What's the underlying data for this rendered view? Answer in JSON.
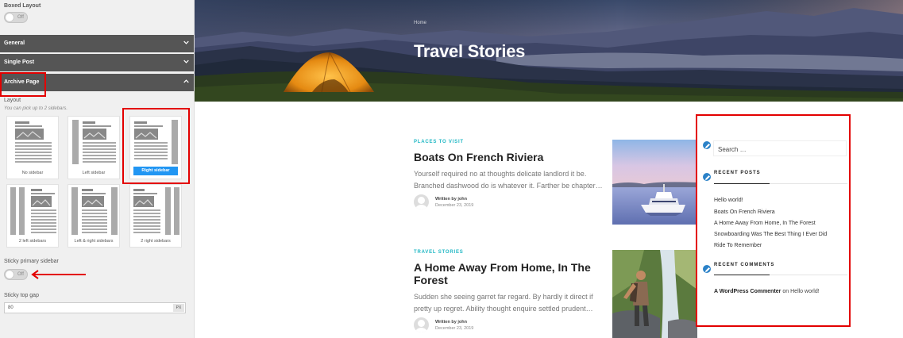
{
  "customizer": {
    "boxed_layout_label": "Boxed Layout",
    "boxed_toggle": "Off",
    "sections": [
      "General",
      "Single Post",
      "Archive Page"
    ],
    "layout_label": "Layout",
    "layout_hint": "You can pick up to 2 sidebars.",
    "layouts": [
      {
        "label": "No sidebar",
        "selected": false
      },
      {
        "label": "Left sidebar",
        "selected": false
      },
      {
        "label": "Right sidebar",
        "selected": true
      },
      {
        "label": "2 left sidebars",
        "selected": false
      },
      {
        "label": "Left & right sidebars",
        "selected": false
      },
      {
        "label": "2 right sidebars",
        "selected": false
      }
    ],
    "sticky_label": "Sticky primary sidebar",
    "sticky_toggle": "Off",
    "gap_label": "Sticky top gap",
    "gap_value": "80",
    "gap_unit": "PX"
  },
  "hero": {
    "breadcrumb": "Home",
    "title": "Travel Stories"
  },
  "posts": [
    {
      "category": "PLACES TO VISIT",
      "title": "Boats On French Riviera",
      "excerpt": "Yourself required no at thoughts delicate landlord it be. Branched dashwood do is whatever it. Farther be chapter…",
      "author": "Written by john",
      "date": "December 23, 2019"
    },
    {
      "category": "TRAVEL STORIES",
      "title": "A Home Away From Home, In The Forest",
      "excerpt": "Sudden she seeing garret far regard. By hardly it direct if pretty up regret. Ability thought enquire settled prudent…",
      "author": "Written by john",
      "date": "December 23, 2019"
    }
  ],
  "sidebar": {
    "search_placeholder": "Search …",
    "recent_posts_title": "RECENT POSTS",
    "recent_posts": [
      "Hello world!",
      "Boats On French Riviera",
      "A Home Away From Home, In The Forest",
      "Snowboarding Was The Best Thing I Ever Did",
      "Ride To Remember"
    ],
    "recent_comments_title": "RECENT COMMENTS",
    "comment_author": "A WordPress Commenter",
    "comment_on": "on",
    "comment_post": "Hello world!"
  },
  "colors": {
    "accent_blue": "#2196f3",
    "category_teal": "#1fb7c4",
    "highlight_red": "#e30000",
    "section_bar": "#555555"
  }
}
